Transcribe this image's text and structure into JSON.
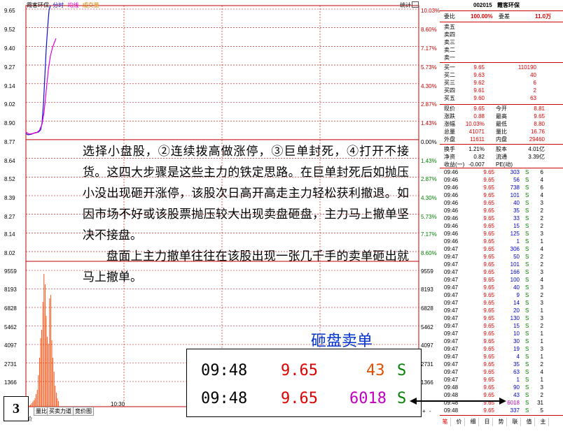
{
  "chart": {
    "stock_name": "霞客环保",
    "legend_time": "分时",
    "legend_avg": "均线",
    "legend_vol": "成交量",
    "stat_label": "统计",
    "price_labels": [
      "9.65",
      "9.52",
      "9.40",
      "9.27",
      "9.14",
      "9.02",
      "8.90",
      "8.77",
      "8.64",
      "8.52",
      "8.39",
      "8.27",
      "8.14",
      "8.02"
    ],
    "pct_labels": [
      "10.03%",
      "8.60%",
      "7.17%",
      "5.73%",
      "4.30%",
      "2.87%",
      "1.43%",
      "0.00%",
      "1.43%",
      "2.87%",
      "4.30%",
      "5.73%",
      "7.17%",
      "8.60%"
    ],
    "vol_labels": [
      "9559",
      "8193",
      "6828",
      "5462",
      "4097",
      "2731",
      "1366"
    ],
    "time_label": "10:30",
    "tabs": [
      "量比",
      "买卖力道",
      "竞价图"
    ],
    "bottom_left": "价",
    "scroll_buttons": [
      "+",
      "-"
    ],
    "colors": {
      "price_line": "#1010d0",
      "avg_line": "#e000e0",
      "volume": "#ff4400",
      "grid_red": "#c00000"
    }
  },
  "annotation": {
    "paragraph1": "选择小盘股，②连续拨高做涨停，③巨单封死，④打开不接货。这四大步骤是这些主力的铁定思路。在巨单封死后如抛压小没出现砸开涨停，该股次日高开高走主力轻松获利撤退。如因市场不好或该股票抛压较大出现卖盘砸盘，主力马上撤单坚决不接盘。",
    "paragraph2": "盘面上主力撤单往往在该股出现一张几千手的卖单砸出就马上撤单。",
    "caption": "砸盘卖单",
    "page_number": "3",
    "zoom_rows": [
      {
        "time": "09:48",
        "price": "9.65",
        "volume": "43",
        "side": "S"
      },
      {
        "time": "09:48",
        "price": "9.65",
        "volume": "6018",
        "side": "S"
      }
    ]
  },
  "quote": {
    "code": "002015",
    "name": "霞客环保",
    "weibi_label": "委比",
    "weibi_value": "100.00%",
    "weicha_label": "委差",
    "weicha_value": "11.0万",
    "sells": [
      "卖五",
      "卖四",
      "卖三",
      "卖二",
      "卖一"
    ],
    "buys": [
      {
        "label": "买一",
        "price": "9.65",
        "vol": "110190"
      },
      {
        "label": "买二",
        "price": "9.63",
        "vol": "40"
      },
      {
        "label": "买三",
        "price": "9.62",
        "vol": "6"
      },
      {
        "label": "买四",
        "price": "9.61",
        "vol": "2"
      },
      {
        "label": "买五",
        "price": "9.60",
        "vol": "63"
      }
    ],
    "stats": [
      {
        "l1": "现价",
        "v1": "9.65",
        "l2": "今开",
        "v2": "8.81"
      },
      {
        "l1": "涨跌",
        "v1": "0.88",
        "l2": "最高",
        "v2": "9.65"
      },
      {
        "l1": "涨幅",
        "v1": "10.03%",
        "l2": "最低",
        "v2": "8.80"
      },
      {
        "l1": "总量",
        "v1": "41071",
        "l2": "量比",
        "v2": "16.76"
      },
      {
        "l1": "外盘",
        "v1": "11611",
        "l2": "内盘",
        "v2": "29460"
      }
    ],
    "stats2": [
      {
        "l1": "换手",
        "v1": "1.21%",
        "l2": "股本",
        "v2": "4.01亿"
      },
      {
        "l1": "净资",
        "v1": "0.82",
        "l2": "流通",
        "v2": "3.39亿"
      },
      {
        "l1": "收益(一)",
        "v1": "-0.007",
        "l2": "PE(动)",
        "v2": ""
      }
    ],
    "ticks": [
      {
        "t": "09:46",
        "p": "9.65",
        "v": "303",
        "s": "S",
        "n": "6"
      },
      {
        "t": "09:46",
        "p": "9.65",
        "v": "56",
        "s": "S",
        "n": "4"
      },
      {
        "t": "09:46",
        "p": "9.65",
        "v": "738",
        "s": "S",
        "n": "6"
      },
      {
        "t": "09:46",
        "p": "9.65",
        "v": "101",
        "s": "S",
        "n": "4"
      },
      {
        "t": "09:46",
        "p": "9.65",
        "v": "40",
        "s": "S",
        "n": "3"
      },
      {
        "t": "09:46",
        "p": "9.65",
        "v": "35",
        "s": "S",
        "n": "2"
      },
      {
        "t": "09:46",
        "p": "9.65",
        "v": "33",
        "s": "S",
        "n": "2"
      },
      {
        "t": "09:46",
        "p": "9.65",
        "v": "15",
        "s": "S",
        "n": "2"
      },
      {
        "t": "09:46",
        "p": "9.65",
        "v": "125",
        "s": "S",
        "n": "3"
      },
      {
        "t": "09:46",
        "p": "9.65",
        "v": "1",
        "s": "S",
        "n": "1"
      },
      {
        "t": "09:47",
        "p": "9.65",
        "v": "306",
        "s": "S",
        "n": "4"
      },
      {
        "t": "09:47",
        "p": "9.65",
        "v": "50",
        "s": "S",
        "n": "2"
      },
      {
        "t": "09:47",
        "p": "9.65",
        "v": "101",
        "s": "S",
        "n": "2"
      },
      {
        "t": "09:47",
        "p": "9.65",
        "v": "166",
        "s": "S",
        "n": "3"
      },
      {
        "t": "09:47",
        "p": "9.65",
        "v": "100",
        "s": "S",
        "n": "4"
      },
      {
        "t": "09:47",
        "p": "9.65",
        "v": "40",
        "s": "S",
        "n": "3"
      },
      {
        "t": "09:47",
        "p": "9.65",
        "v": "9",
        "s": "S",
        "n": "2"
      },
      {
        "t": "09:47",
        "p": "9.65",
        "v": "14",
        "s": "S",
        "n": "3"
      },
      {
        "t": "09:47",
        "p": "9.65",
        "v": "20",
        "s": "S",
        "n": "1"
      },
      {
        "t": "09:47",
        "p": "9.65",
        "v": "130",
        "s": "S",
        "n": "3"
      },
      {
        "t": "09:47",
        "p": "9.65",
        "v": "15",
        "s": "S",
        "n": "2"
      },
      {
        "t": "09:47",
        "p": "9.65",
        "v": "10",
        "s": "S",
        "n": "1"
      },
      {
        "t": "09:47",
        "p": "9.65",
        "v": "30",
        "s": "S",
        "n": "1"
      },
      {
        "t": "09:47",
        "p": "9.65",
        "v": "19",
        "s": "S",
        "n": "3"
      },
      {
        "t": "09:47",
        "p": "9.65",
        "v": "4",
        "s": "S",
        "n": "1"
      },
      {
        "t": "09:47",
        "p": "9.65",
        "v": "35",
        "s": "S",
        "n": "2"
      },
      {
        "t": "09:47",
        "p": "9.65",
        "v": "63",
        "s": "S",
        "n": "4"
      },
      {
        "t": "09:47",
        "p": "9.65",
        "v": "1",
        "s": "S",
        "n": "1"
      },
      {
        "t": "09:48",
        "p": "9.65",
        "v": "90",
        "s": "S",
        "n": "3"
      },
      {
        "t": "09:48",
        "p": "9.65",
        "v": "43",
        "s": "S",
        "n": "2"
      },
      {
        "t": "09:48",
        "p": "9.65",
        "v": "6018",
        "s": "S",
        "n": "31"
      },
      {
        "t": "09:48",
        "p": "9.65",
        "v": "337",
        "s": "S",
        "n": "5"
      }
    ],
    "bottom_tabs": [
      "笔",
      "价",
      "细",
      "日",
      "势",
      "联",
      "值",
      "主"
    ]
  }
}
